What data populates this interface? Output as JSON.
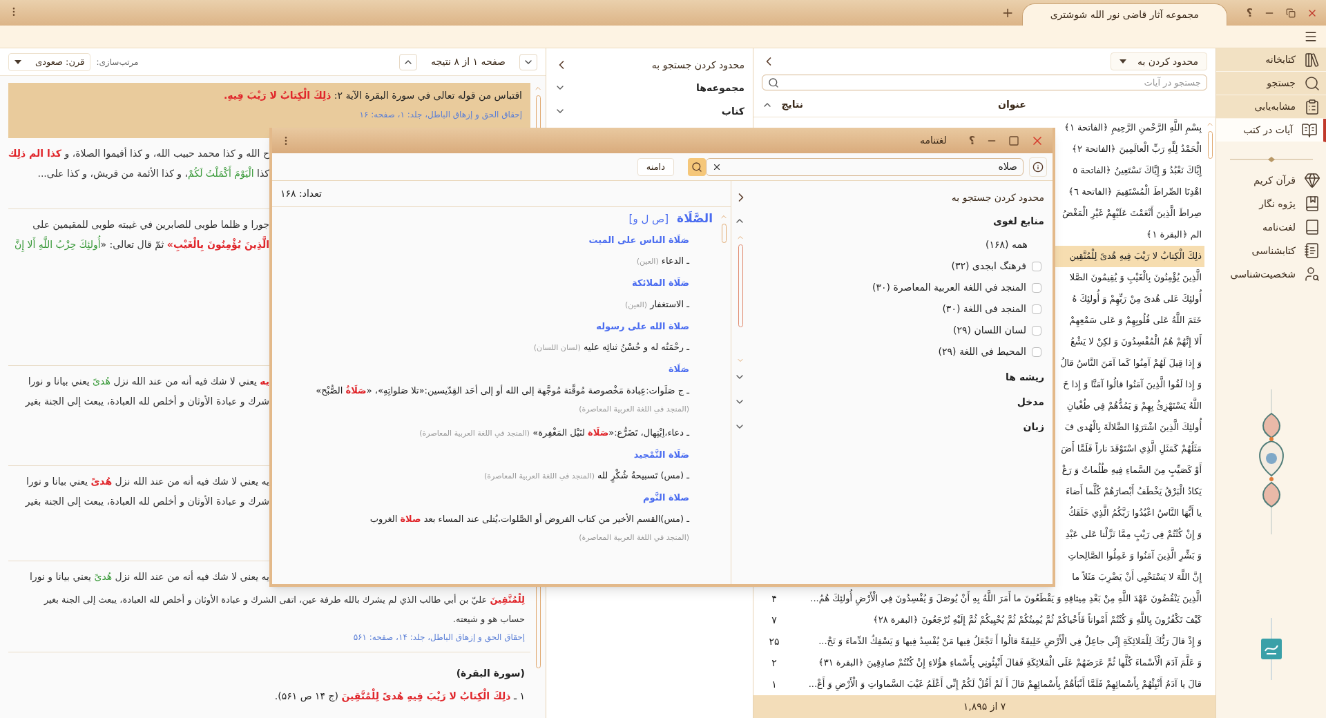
{
  "title_bar": {
    "tab_title": "مجموعه آثار قاضی نور الله شوشتری",
    "new_tab": "+",
    "help": "؟"
  },
  "sidebar": {
    "tools": [
      {
        "label": "کتابخانه",
        "selected": false
      },
      {
        "label": "جستجو",
        "selected": false
      },
      {
        "label": "مشابه‌یابی",
        "selected": false
      },
      {
        "label": "آیات در کتب",
        "selected": true
      }
    ],
    "modules": [
      "قرآن کریم",
      "پژوه نگار",
      "لغت‌نامه",
      "کتابشناسی",
      "شخصیت‌شناسی"
    ]
  },
  "verse_panel": {
    "filter_label": "محدود کردن به",
    "search_placeholder": "جستجو در آیات",
    "columns": [
      "عنوان",
      "نتایج"
    ],
    "rows": [
      {
        "title": "بِسْمِ اللَّهِ الرَّحْمنِ الرَّحِيمِ ﴿الفاتحة ١﴾",
        "selected": false
      },
      {
        "title": "الْحَمْدُ لِلَّهِ رَبِّ الْعالَمِينَ ﴿الفاتحة ٢﴾",
        "selected": false
      },
      {
        "title": "إِيَّاكَ نَعْبُدُ وَ إِيَّاكَ نَسْتَعِينُ ﴿الفاتحة ٥",
        "selected": false
      },
      {
        "title": "اهْدِنَا الصِّراطَ الْمُسْتَقِيمَ ﴿الفاتحة ٦﴾",
        "selected": false
      },
      {
        "title": "صِراطَ الَّذِينَ أَنْعَمْتَ عَلَيْهِمْ غَيْرِ الْمَغْضُ",
        "selected": false
      },
      {
        "title": "الم ﴿البقرة ١﴾",
        "selected": false
      },
      {
        "title": "ذلِكَ الْكِتابُ لا رَيْبَ فِيهِ هُدىً لِلْمُتَّقِين",
        "selected": true
      },
      {
        "title": "الَّذِينَ يُؤْمِنُونَ بِالْغَيْبِ وَ يُقِيمُونَ الصَّلا",
        "selected": false
      },
      {
        "title": "أُولئِكَ عَلى هُدىً مِنْ رَبِّهِمْ وَ أُولئِكَ هُ",
        "selected": false
      },
      {
        "title": "خَتَمَ اللَّهُ عَلى قُلُوبِهِمْ وَ عَلى سَمْعِهِمْ",
        "selected": false
      },
      {
        "title": "أَلا إِنَّهُمْ هُمُ الْمُفْسِدُونَ وَ لكِنْ لا يَشْعُ",
        "selected": false
      },
      {
        "title": "وَ إِذا قِيلَ لَهُمْ آمِنُوا كَما آمَنَ النَّاسُ قالُ",
        "selected": false
      },
      {
        "title": "وَ إِذا لَقُوا الَّذِينَ آمَنُوا قالُوا آمَنَّا وَ إِذا خَ",
        "selected": false
      },
      {
        "title": "اللَّهُ يَسْتَهْزِئُ بِهِمْ وَ يَمُدُّهُمْ فِي طُغْيانِ",
        "selected": false
      },
      {
        "title": "أُولئِكَ الَّذِينَ اشْتَرَوُا الضَّلالَةَ بِالْهُدى فَ",
        "selected": false
      },
      {
        "title": "مَثَلُهُمْ كَمَثَلِ الَّذِي اسْتَوْقَدَ ناراً فَلَمَّا أَضَ",
        "selected": false
      },
      {
        "title": "أَوْ كَصَيِّبٍ مِنَ السَّماءِ فِيهِ ظُلُماتٌ وَ رَعْ",
        "selected": false
      },
      {
        "title": "يَكادُ الْبَرْقُ يَخْطَفُ أَبْصارَهُمْ كُلَّما أَضاءَ",
        "selected": false
      },
      {
        "title": "يا أَيُّهَا النَّاسُ اعْبُدُوا رَبَّكُمُ الَّذِي خَلَقَكُ",
        "selected": false
      },
      {
        "title": "وَ إِنْ كُنْتُمْ فِي رَيْبٍ مِمَّا نَزَّلْنا عَلى عَبْدِ",
        "selected": false
      },
      {
        "title": "وَ بَشِّرِ الَّذِينَ آمَنُوا وَ عَمِلُوا الصَّالِحاتِ",
        "selected": false
      },
      {
        "title": "إِنَّ اللَّهَ لا يَسْتَحْيِي أَنْ يَضْرِبَ مَثَلاً ما",
        "selected": false
      },
      {
        "title": "الَّذِينَ يَنْقُضُونَ عَهْدَ اللَّهِ مِنْ بَعْدِ مِيثاقِهِ وَ يَقْطَعُونَ ما أَمَرَ اللَّهُ بِهِ أَنْ يُوصَلَ وَ يُفْسِدُونَ فِي الْأَرْضِ أُولئِكَ هُمُ...",
        "results": "۴",
        "selected": false
      },
      {
        "title": "كَيْفَ تَكْفُرُونَ بِاللَّهِ وَ كُنْتُمْ أَمْواتاً فَأَحْياكُمْ ثُمَّ يُمِيتُكُمْ ثُمَّ يُحْيِيكُمْ ثُمَّ إِلَيْهِ تُرْجَعُونَ ﴿البقرة ٢٨﴾",
        "results": "۷",
        "selected": false
      },
      {
        "title": "وَ إِذْ قالَ رَبُّكَ لِلْمَلائِكَةِ إِنِّي جاعِلٌ فِي الْأَرْضِ خَلِيفَةً قالُوا أَ تَجْعَلُ فِيها مَنْ يُفْسِدُ فِيها وَ يَسْفِكُ الدِّماءَ وَ نَحْ...",
        "results": "۲۵",
        "selected": false
      },
      {
        "title": "وَ عَلَّمَ آدَمَ الْأَسْماءَ كُلَّها ثُمَّ عَرَضَهُمْ عَلَى الْمَلائِكَةِ فَقالَ أَنْبِئُونِي بِأَسْماءِ هؤُلاءِ إِنْ كُنْتُمْ صادِقِينَ ﴿البقرة ٣١﴾",
        "results": "۲",
        "selected": false
      },
      {
        "title": "قالَ يا آدَمُ أَنْبِئْهُمْ بِأَسْمائِهِمْ فَلَمَّا أَنْبَأَهُمْ بِأَسْمائِهِمْ قالَ أَ لَمْ أَقُلْ لَكُمْ إِنِّي أَعْلَمُ غَيْبَ السَّماواتِ وَ الْأَرْضِ وَ أَعْ...",
        "results": "۱",
        "selected": false
      }
    ],
    "status": "۷ از ۱,۸۹۵"
  },
  "middle_panel": {
    "filter_title": "محدود کردن جستجو به",
    "sections": [
      "مجموعه‌ها",
      "کتاب"
    ]
  },
  "results_panel": {
    "page_info": "صفحه ۱ از ۸ نتیجه",
    "sort_label": "مرتب‌سازی:",
    "sort_value": "قرن: صعودی",
    "top_result": {
      "text": "اقتباس من قوله تعالى في سورة البقرة الآية ۲: **ذلِكَ الْكِتابُ لا رَيْبَ فِيهِ.**",
      "source": "إحقاق الحق و إزهاق الباطل، جلد: ۱، صفحه: ۱۶"
    },
    "side_results": [
      {
        "lines": [
          "ح الله و كذا محمد حبيب الله، و كذا أقيموا الصلاة، و **كذا الم ذلِك**",
          "كذا *الْيَوْمَ أَكْمَلْتُ لَكُمْ*، و كذا الأئمة من قريش، و كذا على..."
        ]
      },
      {
        "lines": [
          "جورا و ظلما طوبى للصابرين في غيبته طوبى للمقيمين على",
          "**الَّذِينَ يُؤْمِنُونَ بِالْغَيْبِ»** ثمّ قال تعالى: «*أُولئِكَ حِزْبُ اللَّهِ أَلا إِنَّ*"
        ]
      },
      {
        "lines": [
          "**ِيه** يعني لا شك فيه أنه من عند الله نزل *هُدىً* يعني بيانا و نورا",
          "شرك و عبادة الأوثان و أخلص لله العبادة، يبعث إلى الجنة بغير"
        ]
      },
      {
        "lines": [
          "ِيه يعني لا شك فيه أنه من عند الله نزل **هُدىً** يعني بيانا و نورا",
          "شرك و عبادة الأوثان و أخلص لله العبادة، يبعث إلى الجنة بغير"
        ]
      },
      {
        "lines": [
          "ِيه يعني لا شك فيه أنه من عند الله نزل *هُدىً* يعني بيانا و نورا"
        ]
      }
    ],
    "lower_result": {
      "lines": [
        "**لِلْمُتَّقِينَ** عليّ بن أبي طالب الذي لم يشرك بالله طرفة عين، اتقى الشرك و عبادة الأوثان و أخلص لله العبادة، يبعث إلى الجنة بغير",
        "حساب هو و شيعته."
      ],
      "source": "إحقاق الحق و إزهاق الباطل، جلد: ۱۴، صفحه: ۵۶۱"
    },
    "surah_heading": "(سورة البقرة)",
    "surah_verse": "١ ـ **ذلِكَ الْكِتابُ لا رَيْبَ فِيهِ هُدىً لِلْمُتَّقِينَ** (ج ۱۴ ص ۵۶۱)."
  },
  "dialog": {
    "title": "لغتنامه",
    "help": "؟",
    "query": "صلاه",
    "scope_button": "دامنه",
    "count": "تعداد: ۱۶۸",
    "entry": {
      "headword": "الصَّلَاة",
      "root": "[ص ل و]",
      "senses": [
        {
          "title": "صَلَاة الناس على الميت",
          "definitions": [
            {
              "text": "ـ الدعاء",
              "source": "(العين)"
            }
          ]
        },
        {
          "title": "صَلَاة الملائكة",
          "definitions": [
            {
              "text": "ـ الاستغفار",
              "source": "(العين)"
            }
          ]
        },
        {
          "title": "صلاة الله على رسوله",
          "definitions": [
            {
              "text": "ـ رحْمَتُه له و حُسْنُ ثنائِه عليه",
              "source": "(لسان اللسان)"
            }
          ]
        },
        {
          "title": "صَلَاة",
          "definitions": [
            {
              "text": "ـ ج صَلَوات:عِبادة مَخْصوصة مُوقَّتة مُوجَّهة إلى الله أو إلى أحَد القِدّيسين:«تلا صَلواتِهِ»، «**صَلَاةُ** الصُّبْح»",
              "source": "(المنجد في اللغة العربية المعاصرة)"
            },
            {
              "text": "ـ دعاء،اِبْتِهال، تَضَرُّع:«**صَلَاة** لنَيْل المَغْفِرة»",
              "source": "(المنجد في اللغة العربية المعاصرة)"
            }
          ]
        },
        {
          "title": "صَلَاة التَّمْجيد",
          "definitions": [
            {
              "text": "ـ (مس) تَسبيحةُ شُكْرٍ لله",
              "source": "(المنجد في اللغة العربية المعاصرة)"
            }
          ]
        },
        {
          "title": "صلاة النَّوم",
          "definitions": [
            {
              "text": "ـ (مس)القسم الأخير من كتاب الفروض أو الصَّلوات،يُتلى عند المساء بعد **صلاة** الغروب",
              "source": "(المنجد في اللغة العربية المعاصرة)"
            }
          ]
        }
      ]
    },
    "filters": {
      "title": "محدود کردن جستجو به",
      "groups": [
        {
          "label": "منابع لغوی",
          "expanded": true,
          "all": "همه (۱۶۸)",
          "options": [
            {
              "label": "فرهنگ ابجدی (۳۲)",
              "checked": false
            },
            {
              "label": "المنجد في اللغة العربية المعاصرة (۳۰)",
              "checked": false
            },
            {
              "label": "المنجد فی اللغة (۳۰)",
              "checked": false
            },
            {
              "label": "لسان اللسان (۲۹)",
              "checked": false
            },
            {
              "label": "المحيط في اللغة (۲۹)",
              "checked": false
            }
          ]
        },
        {
          "label": "ریشه ها",
          "expanded": false
        },
        {
          "label": "مدخل",
          "expanded": false
        },
        {
          "label": "زبان",
          "expanded": false
        }
      ]
    }
  }
}
